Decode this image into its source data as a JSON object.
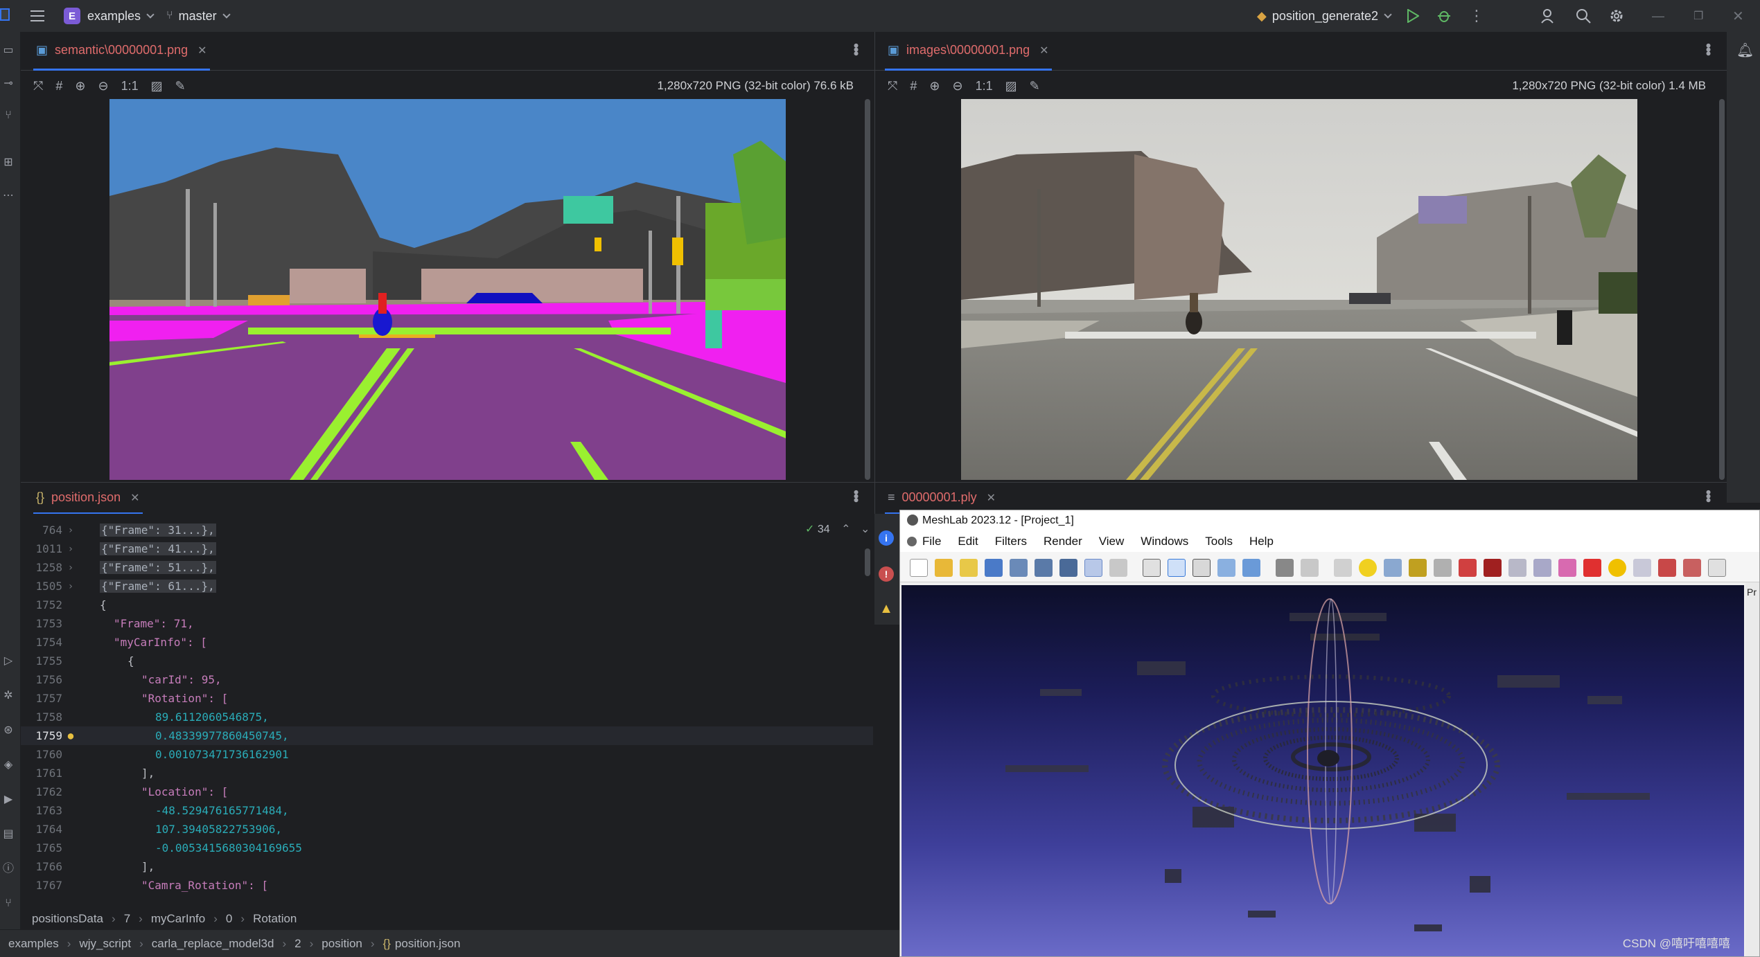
{
  "titlebar": {
    "project_badge": "E",
    "project_name": "examples",
    "branch": "master",
    "run_config": "position_generate2"
  },
  "left_pane": {
    "tab_title": "semantic\\00000001.png",
    "image_info": "1,280x720 PNG (32-bit color) 76.6 kB",
    "zoom_label": "1:1"
  },
  "right_pane": {
    "tab_title": "images\\00000001.png",
    "image_info": "1,280x720 PNG (32-bit color) 1.4 MB",
    "zoom_label": "1:1"
  },
  "editor": {
    "tab_title": "position.json",
    "inspection_count": "34",
    "lines": [
      {
        "num": "764",
        "text": "{\"Frame\": 31...},"
      },
      {
        "num": "1011",
        "text": "{\"Frame\": 41...},"
      },
      {
        "num": "1258",
        "text": "{\"Frame\": 51...},"
      },
      {
        "num": "1505",
        "text": "{\"Frame\": 61...},"
      },
      {
        "num": "1752",
        "text": "{"
      },
      {
        "num": "1753",
        "text": "\"Frame\": 71,"
      },
      {
        "num": "1754",
        "text": "\"myCarInfo\": ["
      },
      {
        "num": "1755",
        "text": "{"
      },
      {
        "num": "1756",
        "text": "\"carId\": 95,"
      },
      {
        "num": "1757",
        "text": "\"Rotation\": ["
      },
      {
        "num": "1758",
        "text": "89.6112060546875,"
      },
      {
        "num": "1759",
        "text": "0.48339977860450745,"
      },
      {
        "num": "1760",
        "text": "0.001073471736162901"
      },
      {
        "num": "1761",
        "text": "],"
      },
      {
        "num": "1762",
        "text": "\"Location\": ["
      },
      {
        "num": "1763",
        "text": "-48.529476165771484,"
      },
      {
        "num": "1764",
        "text": "107.39405822753906,"
      },
      {
        "num": "1765",
        "text": "-0.0053415680304169655"
      },
      {
        "num": "1766",
        "text": "],"
      },
      {
        "num": "1767",
        "text": "\"Camra_Rotation\": ["
      }
    ],
    "json_path": [
      "positionsData",
      "7",
      "myCarInfo",
      "0",
      "Rotation"
    ]
  },
  "ply_tab": {
    "tab_title": "00000001.ply"
  },
  "meshlab": {
    "title": "MeshLab 2023.12 - [Project_1]",
    "menu": [
      "File",
      "Edit",
      "Filters",
      "Render",
      "View",
      "Windows",
      "Tools",
      "Help"
    ],
    "side_label": "Pr"
  },
  "statusbar": {
    "path": [
      "examples",
      "wjy_script",
      "carla_replace_model3d",
      "2",
      "position",
      "position.json"
    ]
  },
  "watermark": "CSDN @嘻吁嘻嘻嘻"
}
